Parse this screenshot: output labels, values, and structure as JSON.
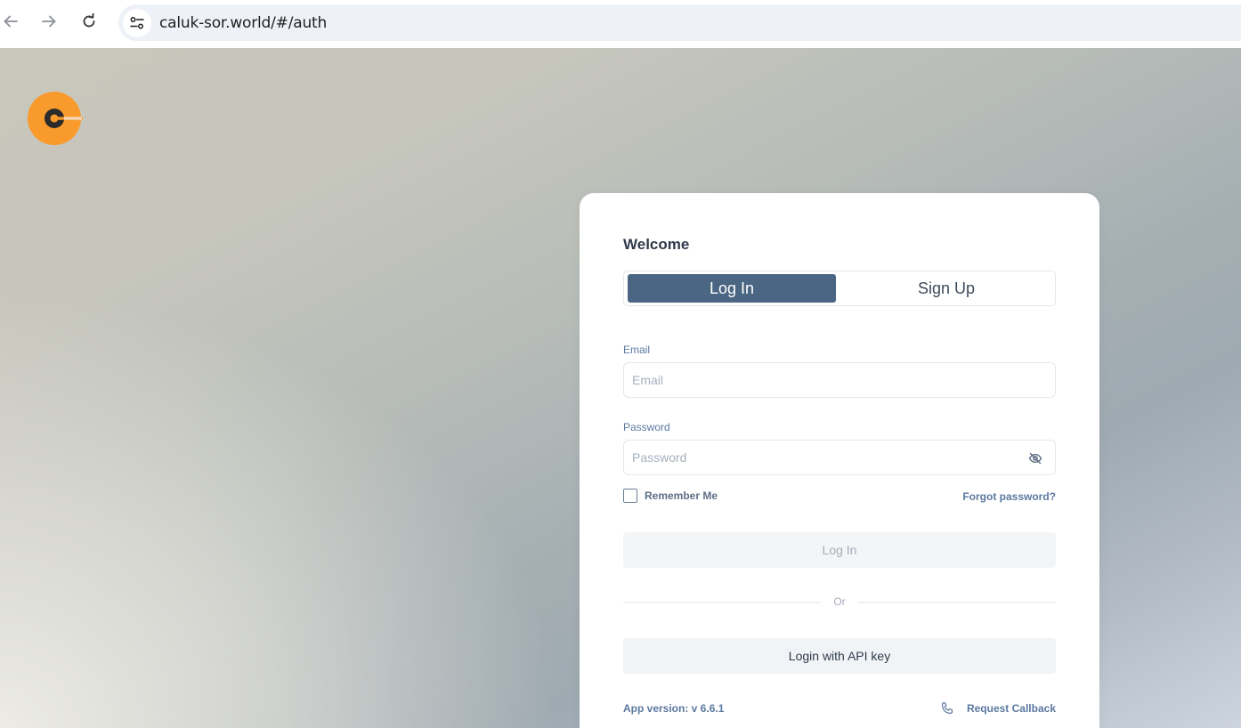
{
  "browser": {
    "url": "caluk-sor.world/#/auth",
    "icons": [
      "back-arrow-icon",
      "forward-arrow-icon",
      "reload-icon",
      "site-settings-icon"
    ]
  },
  "colors": {
    "accent": "#4b6683",
    "logo": "#f99a2d",
    "link": "#5c79a0"
  },
  "auth": {
    "title": "Welcome",
    "tabs": [
      {
        "label": "Log In",
        "active": true
      },
      {
        "label": "Sign Up",
        "active": false
      }
    ],
    "email": {
      "label": "Email",
      "placeholder": "Email",
      "value": ""
    },
    "password": {
      "label": "Password",
      "placeholder": "Password",
      "value": "",
      "toggle_icon": "eye-off-icon"
    },
    "remember_me": {
      "label": "Remember Me",
      "checked": false
    },
    "forgot_password": "Forgot password?",
    "login_button": "Log In",
    "divider_text": "Or",
    "api_key_button": "Login with API key",
    "app_version": "App version: v 6.6.1",
    "request_callback": {
      "label": "Request Callback",
      "icon": "phone-icon"
    }
  }
}
